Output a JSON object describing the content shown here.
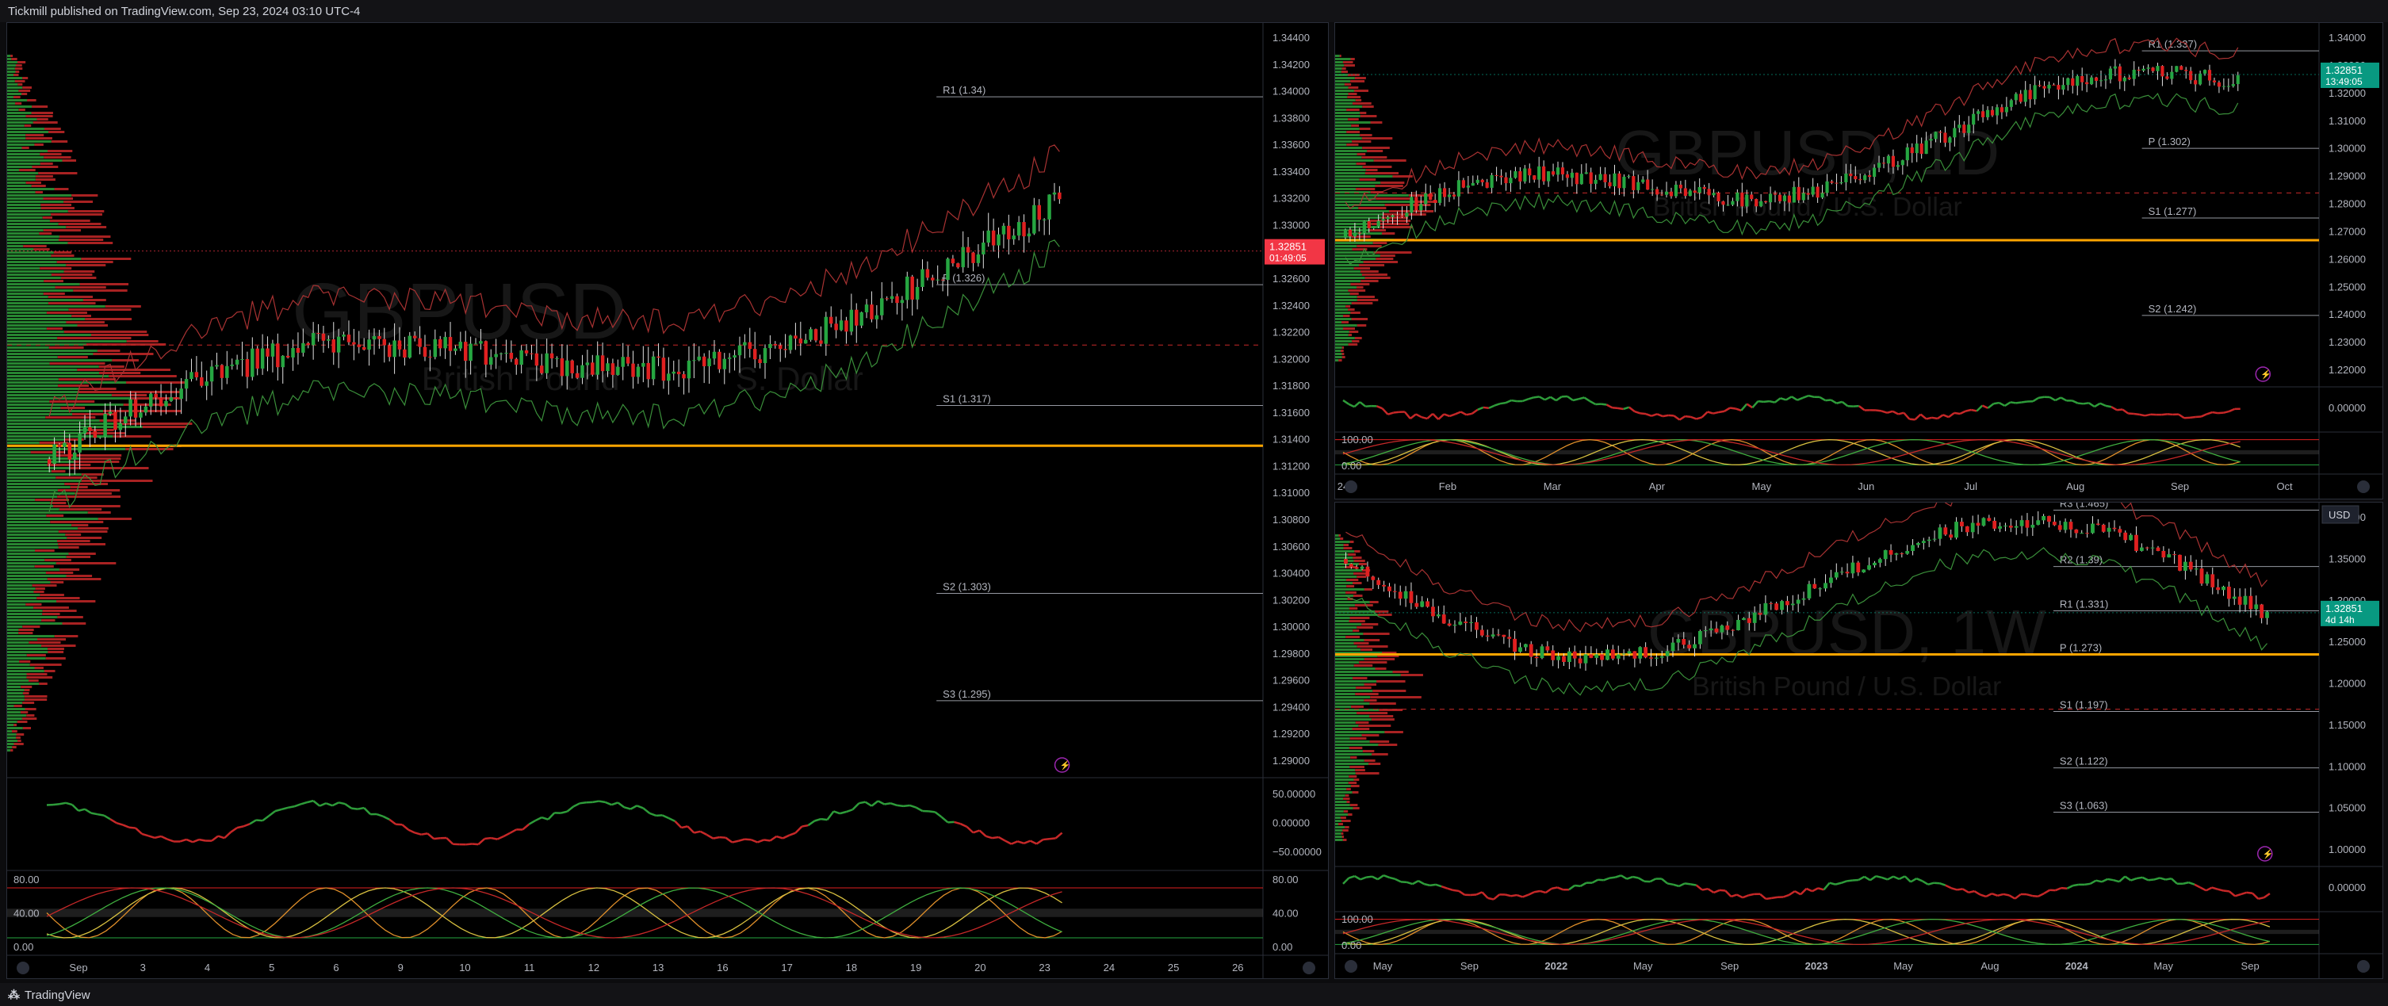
{
  "header": {
    "published": "Tickmill published on TradingView.com, Sep 23, 2024 03:10 UTC-4"
  },
  "footer": {
    "brand": "TradingView"
  },
  "icons": [
    "lightning-icon",
    "zoom-icon",
    "auto-scale-icon",
    "tradingview-logo-icon"
  ],
  "colors": {
    "bull": "#26a641",
    "bear": "#e02020",
    "pivot": "#ffa500",
    "price_badge_red": "#f23645",
    "price_badge_green": "#089981"
  },
  "main_chart": {
    "watermark_symbol": "GBPUSD",
    "watermark_desc_left": "British Pound",
    "watermark_desc_right": "S. Dollar",
    "price_axis": [
      "1.34400",
      "1.34200",
      "1.34000",
      "1.33800",
      "1.33600",
      "1.33400",
      "1.33200",
      "1.33000",
      "1.32800",
      "1.32600",
      "1.32400",
      "1.32200",
      "1.32000",
      "1.31800",
      "1.31600",
      "1.31400",
      "1.31200",
      "1.31000",
      "1.30800",
      "1.30600",
      "1.30400",
      "1.30200",
      "1.30000",
      "1.29800",
      "1.29600",
      "1.29400",
      "1.29200",
      "1.29000"
    ],
    "last_price": "1.32851",
    "countdown": "01:49:05",
    "pivots": [
      {
        "label": "R1 (1.34)",
        "value": 1.34
      },
      {
        "label": "P (1.326)",
        "value": 1.326
      },
      {
        "label": "S1 (1.317)",
        "value": 1.317
      },
      {
        "label": "S2 (1.303)",
        "value": 1.303
      },
      {
        "label": "S3 (1.295)",
        "value": 1.295
      }
    ],
    "time_axis": [
      "Sep",
      "3",
      "4",
      "5",
      "6",
      "9",
      "10",
      "11",
      "12",
      "13",
      "16",
      "17",
      "18",
      "19",
      "20",
      "23",
      "24",
      "25",
      "26"
    ],
    "osc1_axis": [
      "50.00000",
      "0.00000",
      "−50.00000"
    ],
    "osc2_axis": [
      "80.00",
      "40.00",
      "0.00"
    ],
    "osc2_right_axis": [
      "80.00",
      "40.00",
      "0.00"
    ]
  },
  "daily_chart": {
    "watermark_symbol": "GBPUSD, 1D",
    "watermark_desc": "British Pound / U.S. Dollar",
    "price_axis": [
      "1.34000",
      "1.33000",
      "1.32000",
      "1.31000",
      "1.30000",
      "1.29000",
      "1.28000",
      "1.27000",
      "1.26000",
      "1.25000",
      "1.24000",
      "1.23000",
      "1.22000"
    ],
    "last_price": "1.32851",
    "countdown": "13:49:05",
    "pivots": [
      {
        "label": "R1 (1.337)",
        "value": 1.337
      },
      {
        "label": "P (1.302)",
        "value": 1.302
      },
      {
        "label": "S1 (1.277)",
        "value": 1.277
      },
      {
        "label": "S2 (1.242)",
        "value": 1.242
      }
    ],
    "time_axis": [
      "24",
      "Feb",
      "Mar",
      "Apr",
      "May",
      "Jun",
      "Jul",
      "Aug",
      "Sep",
      "Oct"
    ],
    "osc1_axis": [
      "0.00000"
    ],
    "osc2_axis": [
      "100.00",
      "0.00"
    ]
  },
  "weekly_chart": {
    "watermark_symbol": "GBPUSD, 1W",
    "watermark_desc": "British Pound / U.S. Dollar",
    "currency": "USD",
    "price_axis": [
      "1.40000",
      "1.35000",
      "1.30000",
      "1.25000",
      "1.20000",
      "1.15000",
      "1.10000",
      "1.05000",
      "1.00000"
    ],
    "last_price": "1.32851",
    "countdown": "4d 14h",
    "pivots": [
      {
        "label": "R3 (1.465)",
        "value": 1.465
      },
      {
        "label": "R2 (1.39)",
        "value": 1.39
      },
      {
        "label": "R1 (1.331)",
        "value": 1.331
      },
      {
        "label": "P (1.273)",
        "value": 1.273
      },
      {
        "label": "S1 (1.197)",
        "value": 1.197
      },
      {
        "label": "S2 (1.122)",
        "value": 1.122
      },
      {
        "label": "S3 (1.063)",
        "value": 1.063
      }
    ],
    "time_axis": [
      "May",
      "Sep",
      "2022",
      "May",
      "Sep",
      "2023",
      "May",
      "Aug",
      "2024",
      "May",
      "Sep"
    ],
    "osc1_axis": [
      "0.00000"
    ],
    "osc2_axis": [
      "100.00",
      "0.00"
    ]
  }
}
